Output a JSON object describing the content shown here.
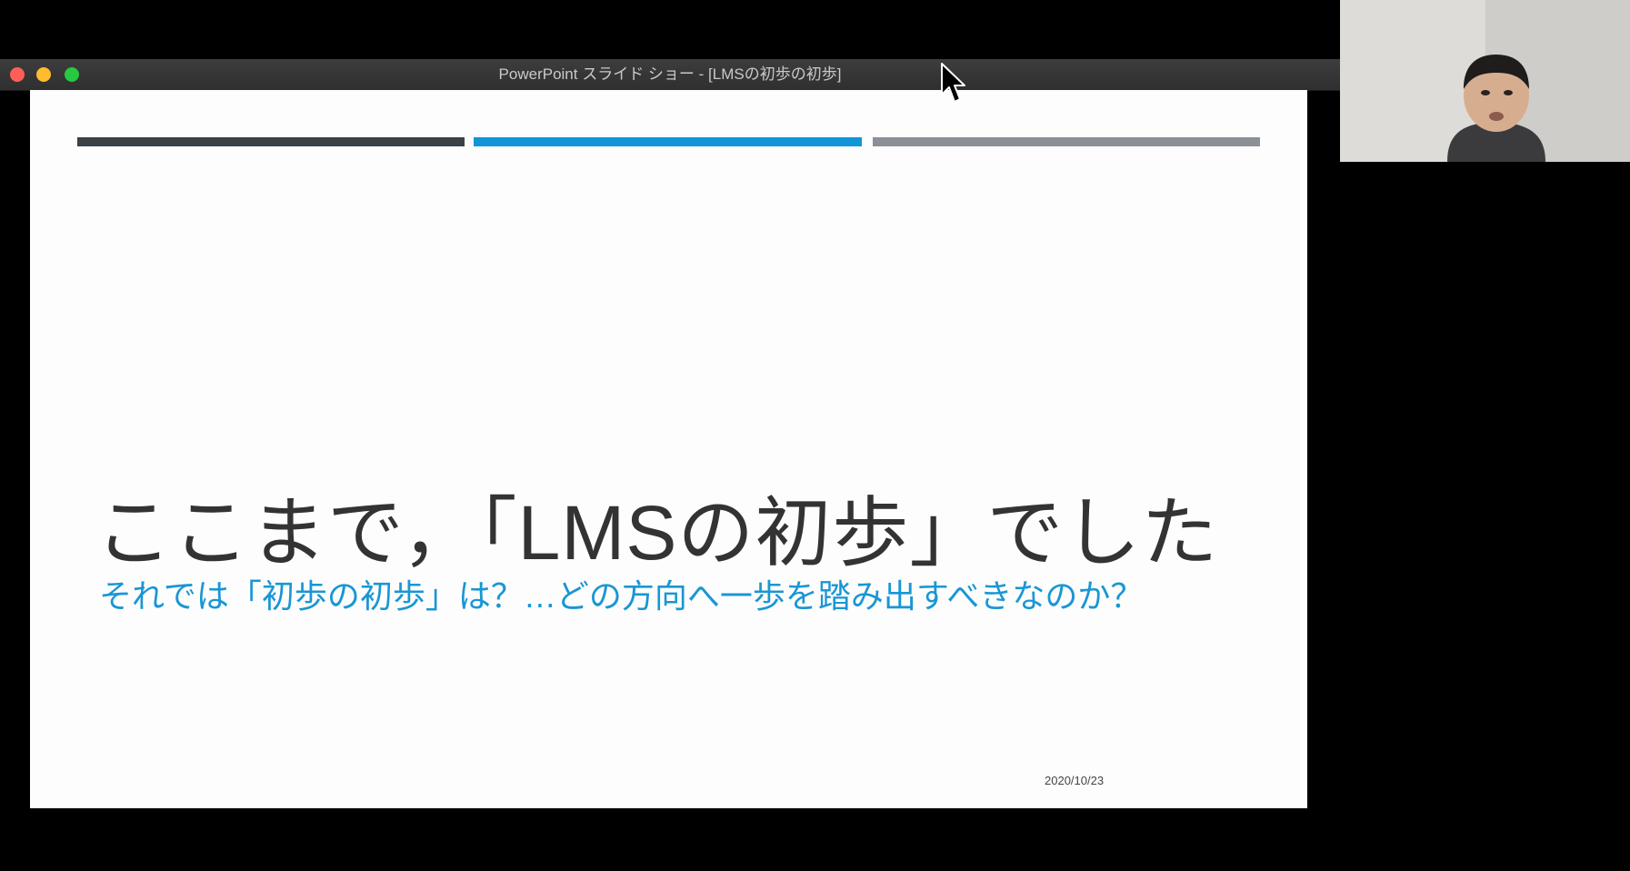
{
  "window": {
    "title": "PowerPoint スライド ショー - [LMSの初歩の初歩]",
    "controls": [
      "close",
      "minimize",
      "maximize"
    ]
  },
  "slide": {
    "title": "ここまで，「LMSの初歩」でした",
    "subtitle": "それでは「初歩の初歩」は？…どの方向へ一歩を踏み出すべきなのか？",
    "date": "2020/10/23",
    "accent_colors": [
      "#3a4147",
      "#0f95d8",
      "#8a9096"
    ]
  },
  "webcam": {
    "icon": "person-video-feed"
  },
  "cursor": {
    "icon": "arrow-pointer-icon"
  }
}
